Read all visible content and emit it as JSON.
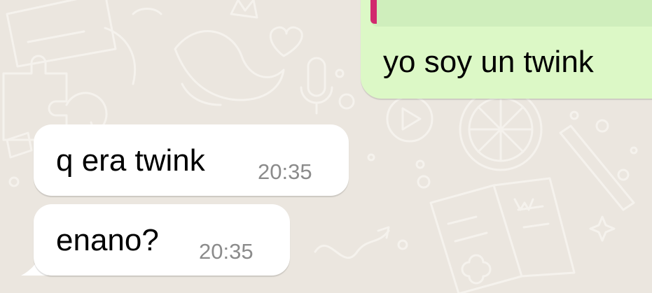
{
  "colors": {
    "wallpaper": "#ebe6df",
    "incoming_bubble": "#ffffff",
    "outgoing_bubble": "#dcf8c6",
    "reply_accent": "#d1296e",
    "timestamp": "#8b8b8b"
  },
  "outgoing": {
    "text": "yo soy un twink"
  },
  "incoming": [
    {
      "text": "q era twink",
      "time": "20:35"
    },
    {
      "text": "enano?",
      "time": "20:35"
    }
  ]
}
